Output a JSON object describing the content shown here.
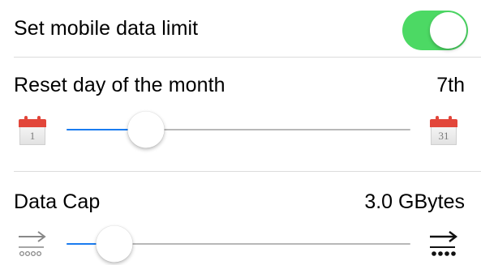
{
  "colors": {
    "toggle_on": "#4cd964",
    "slider_fill": "#1a7cf0"
  },
  "mobile_data_limit": {
    "label": "Set mobile data limit",
    "enabled": true
  },
  "reset_day": {
    "label": "Reset day of the month",
    "value": "7th",
    "slider_fraction": 0.23,
    "min_icon": "calendar-icon",
    "min_icon_text": "1",
    "max_icon": "calendar-icon",
    "max_icon_text": "31"
  },
  "data_cap": {
    "label": "Data Cap",
    "value": "3.0 GBytes",
    "slider_fraction": 0.14,
    "min_icon": "arrow-dotted-light-icon",
    "max_icon": "arrow-dotted-dark-icon"
  }
}
